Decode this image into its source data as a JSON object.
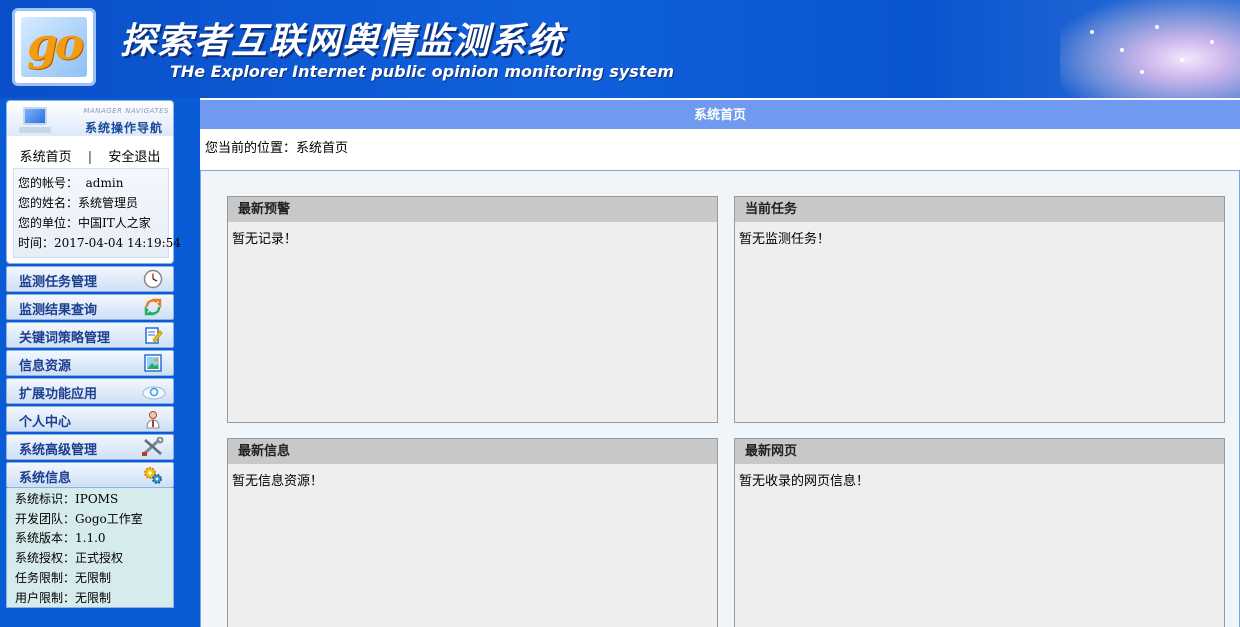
{
  "header": {
    "logo_text": "go",
    "title_cn": "探索者互联网舆情监测系统",
    "title_en": "THe Explorer Internet public opinion monitoring system"
  },
  "sidebar": {
    "nav_subtitle": "MANAGER NAVIGATES",
    "nav_title": "系统操作导航",
    "links": {
      "home": "系统首页",
      "separator": "|",
      "logout": "安全退出"
    },
    "user": {
      "account_label": "您的帐号：",
      "account": "admin",
      "name_label": "您的姓名：",
      "name": "系统管理员",
      "unit_label": "您的单位：",
      "unit": "中国IT人之家",
      "time_label": "时间：",
      "time": "2017-04-04 14:19:54"
    },
    "menu": [
      {
        "label": "监测任务管理",
        "icon": "clock-icon"
      },
      {
        "label": "监测结果查询",
        "icon": "refresh-arrows-icon"
      },
      {
        "label": "关键词策略管理",
        "icon": "edit-document-icon"
      },
      {
        "label": "信息资源",
        "icon": "picture-icon"
      },
      {
        "label": "扩展功能应用",
        "icon": "cloud-sync-icon"
      },
      {
        "label": "个人中心",
        "icon": "user-icon"
      },
      {
        "label": "系统高级管理",
        "icon": "tools-icon"
      },
      {
        "label": "系统信息",
        "icon": "gears-icon"
      }
    ],
    "sysinfo": [
      {
        "label": "系统标识：",
        "value": "IPOMS"
      },
      {
        "label": "开发团队：",
        "value": "Gogo工作室"
      },
      {
        "label": "系统版本：",
        "value": "1.1.0"
      },
      {
        "label": "系统授权：",
        "value": "正式授权"
      },
      {
        "label": "任务限制：",
        "value": "无限制"
      },
      {
        "label": "用户限制：",
        "value": "无限制"
      }
    ]
  },
  "main": {
    "title": "系统首页",
    "breadcrumb_label": "您当前的位置：",
    "breadcrumb_value": "系统首页",
    "panels": [
      {
        "title": "最新预警",
        "body": "暂无记录！"
      },
      {
        "title": "当前任务",
        "body": "暂无监测任务！"
      },
      {
        "title": "最新信息",
        "body": "暂无信息资源！"
      },
      {
        "title": "最新网页",
        "body": "暂无收录的网页信息！"
      }
    ]
  }
}
